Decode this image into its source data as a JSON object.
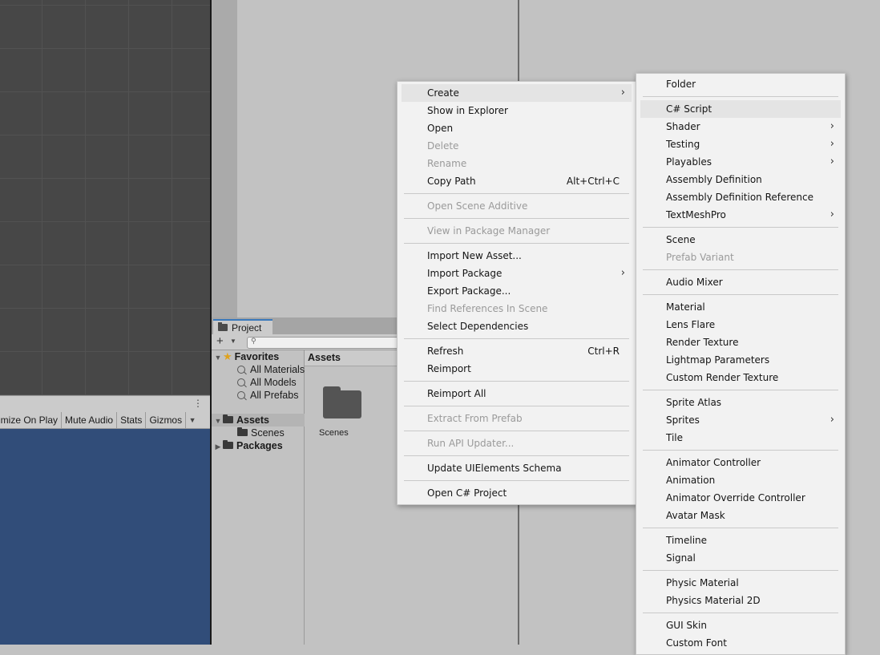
{
  "game_toolbar": {
    "items": [
      "imize On Play",
      "Mute Audio",
      "Stats",
      "Gizmos"
    ],
    "dots": "⋮"
  },
  "project": {
    "tab_label": "Project",
    "add_label": "+",
    "favorites": {
      "label": "Favorites",
      "items": [
        "All Materials",
        "All Models",
        "All Prefabs"
      ]
    },
    "assets_label": "Assets",
    "scenes_label": "Scenes",
    "packages_label": "Packages",
    "assets_header": "Assets",
    "grid_items": [
      "Scenes"
    ]
  },
  "context_menu": {
    "items": [
      {
        "label": "Create",
        "submenu": true,
        "highlighted": true
      },
      {
        "label": "Show in Explorer"
      },
      {
        "label": "Open"
      },
      {
        "label": "Delete",
        "disabled": true
      },
      {
        "label": "Rename",
        "disabled": true
      },
      {
        "label": "Copy Path",
        "shortcut": "Alt+Ctrl+C"
      },
      {
        "separator": true
      },
      {
        "label": "Open Scene Additive",
        "disabled": true
      },
      {
        "separator": true
      },
      {
        "label": "View in Package Manager",
        "disabled": true
      },
      {
        "separator": true
      },
      {
        "label": "Import New Asset..."
      },
      {
        "label": "Import Package",
        "submenu": true
      },
      {
        "label": "Export Package..."
      },
      {
        "label": "Find References In Scene",
        "disabled": true
      },
      {
        "label": "Select Dependencies"
      },
      {
        "separator": true
      },
      {
        "label": "Refresh",
        "shortcut": "Ctrl+R"
      },
      {
        "label": "Reimport"
      },
      {
        "separator": true
      },
      {
        "label": "Reimport All"
      },
      {
        "separator": true
      },
      {
        "label": "Extract From Prefab",
        "disabled": true
      },
      {
        "separator": true
      },
      {
        "label": "Run API Updater...",
        "disabled": true
      },
      {
        "separator": true
      },
      {
        "label": "Update UIElements Schema"
      },
      {
        "separator": true
      },
      {
        "label": "Open C# Project"
      }
    ]
  },
  "create_menu": {
    "items": [
      {
        "label": "Folder"
      },
      {
        "separator": true
      },
      {
        "label": "C# Script",
        "highlighted": true
      },
      {
        "label": "Shader",
        "submenu": true
      },
      {
        "label": "Testing",
        "submenu": true
      },
      {
        "label": "Playables",
        "submenu": true
      },
      {
        "label": "Assembly Definition"
      },
      {
        "label": "Assembly Definition Reference"
      },
      {
        "label": "TextMeshPro",
        "submenu": true
      },
      {
        "separator": true
      },
      {
        "label": "Scene"
      },
      {
        "label": "Prefab Variant",
        "disabled": true
      },
      {
        "separator": true
      },
      {
        "label": "Audio Mixer"
      },
      {
        "separator": true
      },
      {
        "label": "Material"
      },
      {
        "label": "Lens Flare"
      },
      {
        "label": "Render Texture"
      },
      {
        "label": "Lightmap Parameters"
      },
      {
        "label": "Custom Render Texture"
      },
      {
        "separator": true
      },
      {
        "label": "Sprite Atlas"
      },
      {
        "label": "Sprites",
        "submenu": true
      },
      {
        "label": "Tile"
      },
      {
        "separator": true
      },
      {
        "label": "Animator Controller"
      },
      {
        "label": "Animation"
      },
      {
        "label": "Animator Override Controller"
      },
      {
        "label": "Avatar Mask"
      },
      {
        "separator": true
      },
      {
        "label": "Timeline"
      },
      {
        "label": "Signal"
      },
      {
        "separator": true
      },
      {
        "label": "Physic Material"
      },
      {
        "label": "Physics Material 2D"
      },
      {
        "separator": true
      },
      {
        "label": "GUI Skin"
      },
      {
        "label": "Custom Font"
      }
    ]
  },
  "colors": {
    "scene_bg": "#474747",
    "game_bg": "#314d79",
    "tab_accent": "#3a79bb",
    "star": "#e0a21c"
  }
}
